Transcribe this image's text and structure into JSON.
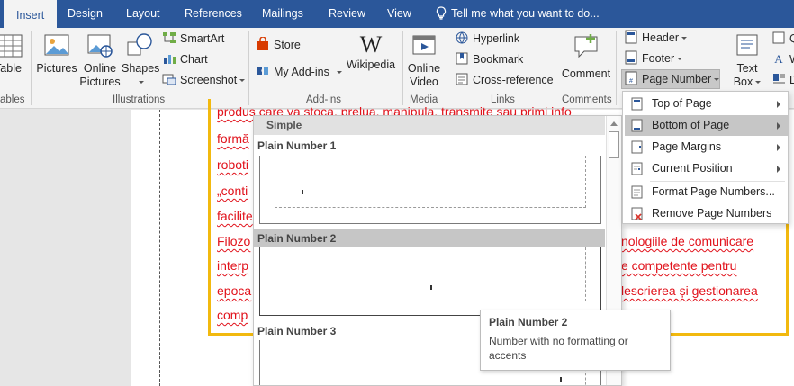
{
  "tabs": [
    "Insert",
    "Design",
    "Layout",
    "References",
    "Mailings",
    "Review",
    "View"
  ],
  "tell_me": "Tell me what you want to do...",
  "ribbon": {
    "table_label": "Table",
    "illustrations": {
      "pictures": "Pictures",
      "online_pictures_1": "Online",
      "online_pictures_2": "Pictures",
      "shapes": "Shapes",
      "smartart": "SmartArt",
      "chart": "Chart",
      "screenshot": "Screenshot"
    },
    "addins": {
      "store": "Store",
      "my_addins": "My Add-ins",
      "wikipedia": "Wikipedia"
    },
    "media": {
      "online_video_1": "Online",
      "online_video_2": "Video"
    },
    "links": {
      "hyperlink": "Hyperlink",
      "bookmark": "Bookmark",
      "cross_reference": "Cross-reference"
    },
    "comments": {
      "comment": "Comment"
    },
    "header_footer": {
      "header": "Header",
      "footer": "Footer",
      "page_number": "Page Number"
    },
    "text": {
      "text_box_1": "Text",
      "text_box_2": "Box",
      "q": "Q",
      "w": "W",
      "d": "D"
    },
    "groups": {
      "tables": "ables",
      "illustrations": "Illustrations",
      "addins": "Add-ins",
      "media": "Media",
      "links": "Links",
      "comments": "Comments"
    }
  },
  "document": {
    "lines_left": [
      "produs care va stoca, prelua, manipula, transmite sau primi info",
      "formă",
      "roboti",
      "„conti",
      "facilite",
      "Filozo",
      "interp",
      "epoca",
      "comp"
    ],
    "lines_right": [
      "nologiile de comunicare",
      "e competente pentru",
      "lescrierea și gestionarea"
    ]
  },
  "gallery": {
    "section": "Simple",
    "items": [
      "Plain Number 1",
      "Plain Number 2",
      "Plain Number 3"
    ]
  },
  "submenu": {
    "items": [
      "Top of Page",
      "Bottom of Page",
      "Page Margins",
      "Current Position",
      "Format Page Numbers...",
      "Remove Page Numbers"
    ]
  },
  "tooltip": {
    "title": "Plain Number 2",
    "body": "Number with no formatting or accents"
  },
  "colors": {
    "tabbar": "#2b579a",
    "ribbon": "#f3f3f3",
    "document_text": "#e1121b",
    "textbox_border": "#f2b90f",
    "highlight": "#c6c6c6"
  }
}
